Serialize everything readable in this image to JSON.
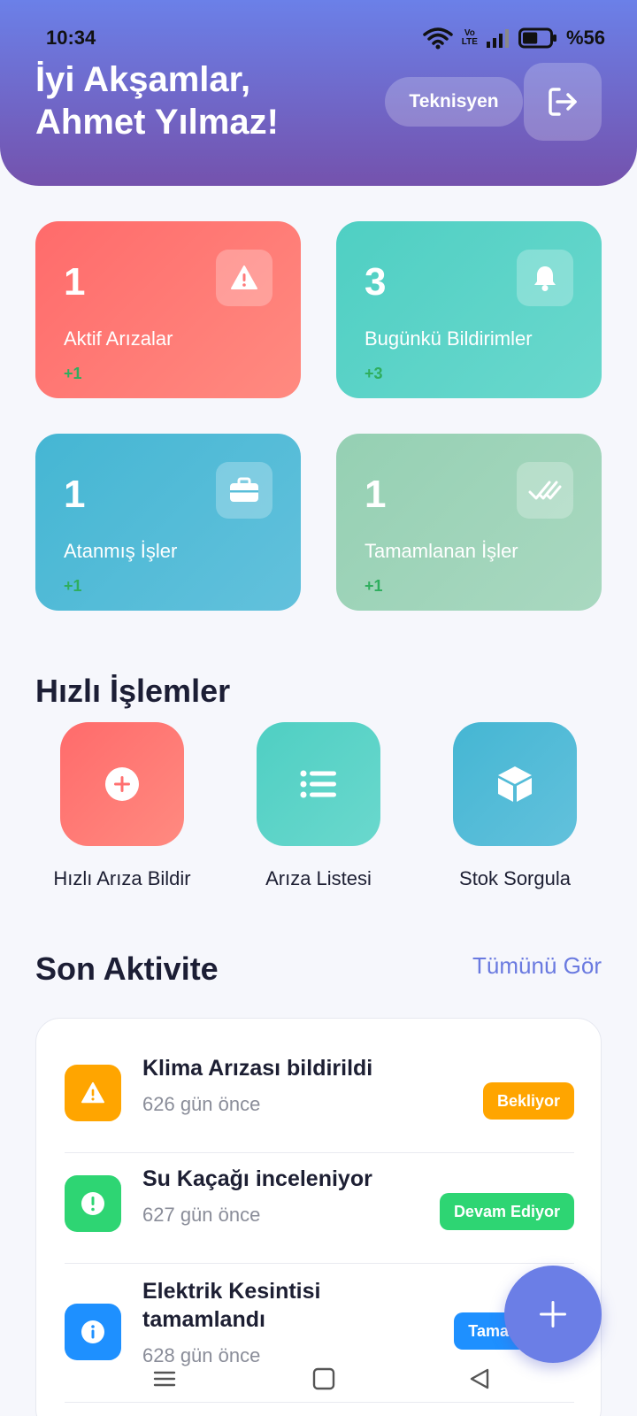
{
  "status_bar": {
    "time": "10:34",
    "network_label_top": "Vo",
    "network_label_bottom": "LTE",
    "battery_text": "%56",
    "battery_level": 0.56
  },
  "header": {
    "greeting_line1": "İyi Akşamlar,",
    "greeting_line2": "Ahmet Yılmaz!",
    "role": "Teknisyen",
    "logout_icon": "logout-icon"
  },
  "stats": [
    {
      "count": "1",
      "label": "Aktif Arızalar",
      "delta": "+1",
      "icon": "warning-icon",
      "color": "#ff6b6b"
    },
    {
      "count": "3",
      "label": "Bugünkü Bildirimler",
      "delta": "+3",
      "icon": "bell-icon",
      "color": "#4fcfc3"
    },
    {
      "count": "1",
      "label": "Atanmış İşler",
      "delta": "+1",
      "icon": "briefcase-icon",
      "color": "#45b6d3"
    },
    {
      "count": "1",
      "label": "Tamamlanan İşler",
      "delta": "+1",
      "icon": "double-check-icon",
      "color": "#95d0b3"
    }
  ],
  "quick_actions": {
    "title": "Hızlı İşlemler",
    "items": [
      {
        "label": "Hızlı Arıza Bildir",
        "icon": "plus-circle-icon"
      },
      {
        "label": "Arıza Listesi",
        "icon": "list-icon"
      },
      {
        "label": "Stok Sorgula",
        "icon": "box-icon"
      }
    ]
  },
  "activity": {
    "title": "Son Aktivite",
    "see_all": "Tümünü Gör",
    "items": [
      {
        "title": "Klima Arızası bildirildi",
        "time": "626 gün önce",
        "status": "Bekliyor",
        "status_color": "#ffa500",
        "icon": "warning-icon",
        "icon_color": "#ffa500"
      },
      {
        "title": "Su Kaçağı inceleniyor",
        "time": "627 gün önce",
        "status": "Devam Ediyor",
        "status_color": "#2ed573",
        "icon": "exclamation-icon",
        "icon_color": "#2ed573"
      },
      {
        "title_line1": "Elektrik Kesintisi",
        "title_line2": "tamamlandı",
        "time": "628 gün önce",
        "status": "Tamamlandı",
        "status_color": "#1e90ff",
        "icon": "info-icon",
        "icon_color": "#1e90ff"
      }
    ]
  },
  "fab": {
    "icon": "plus-icon"
  },
  "colors": {
    "accent": "#6b7ee6",
    "delta_green": "#2fae5e"
  }
}
